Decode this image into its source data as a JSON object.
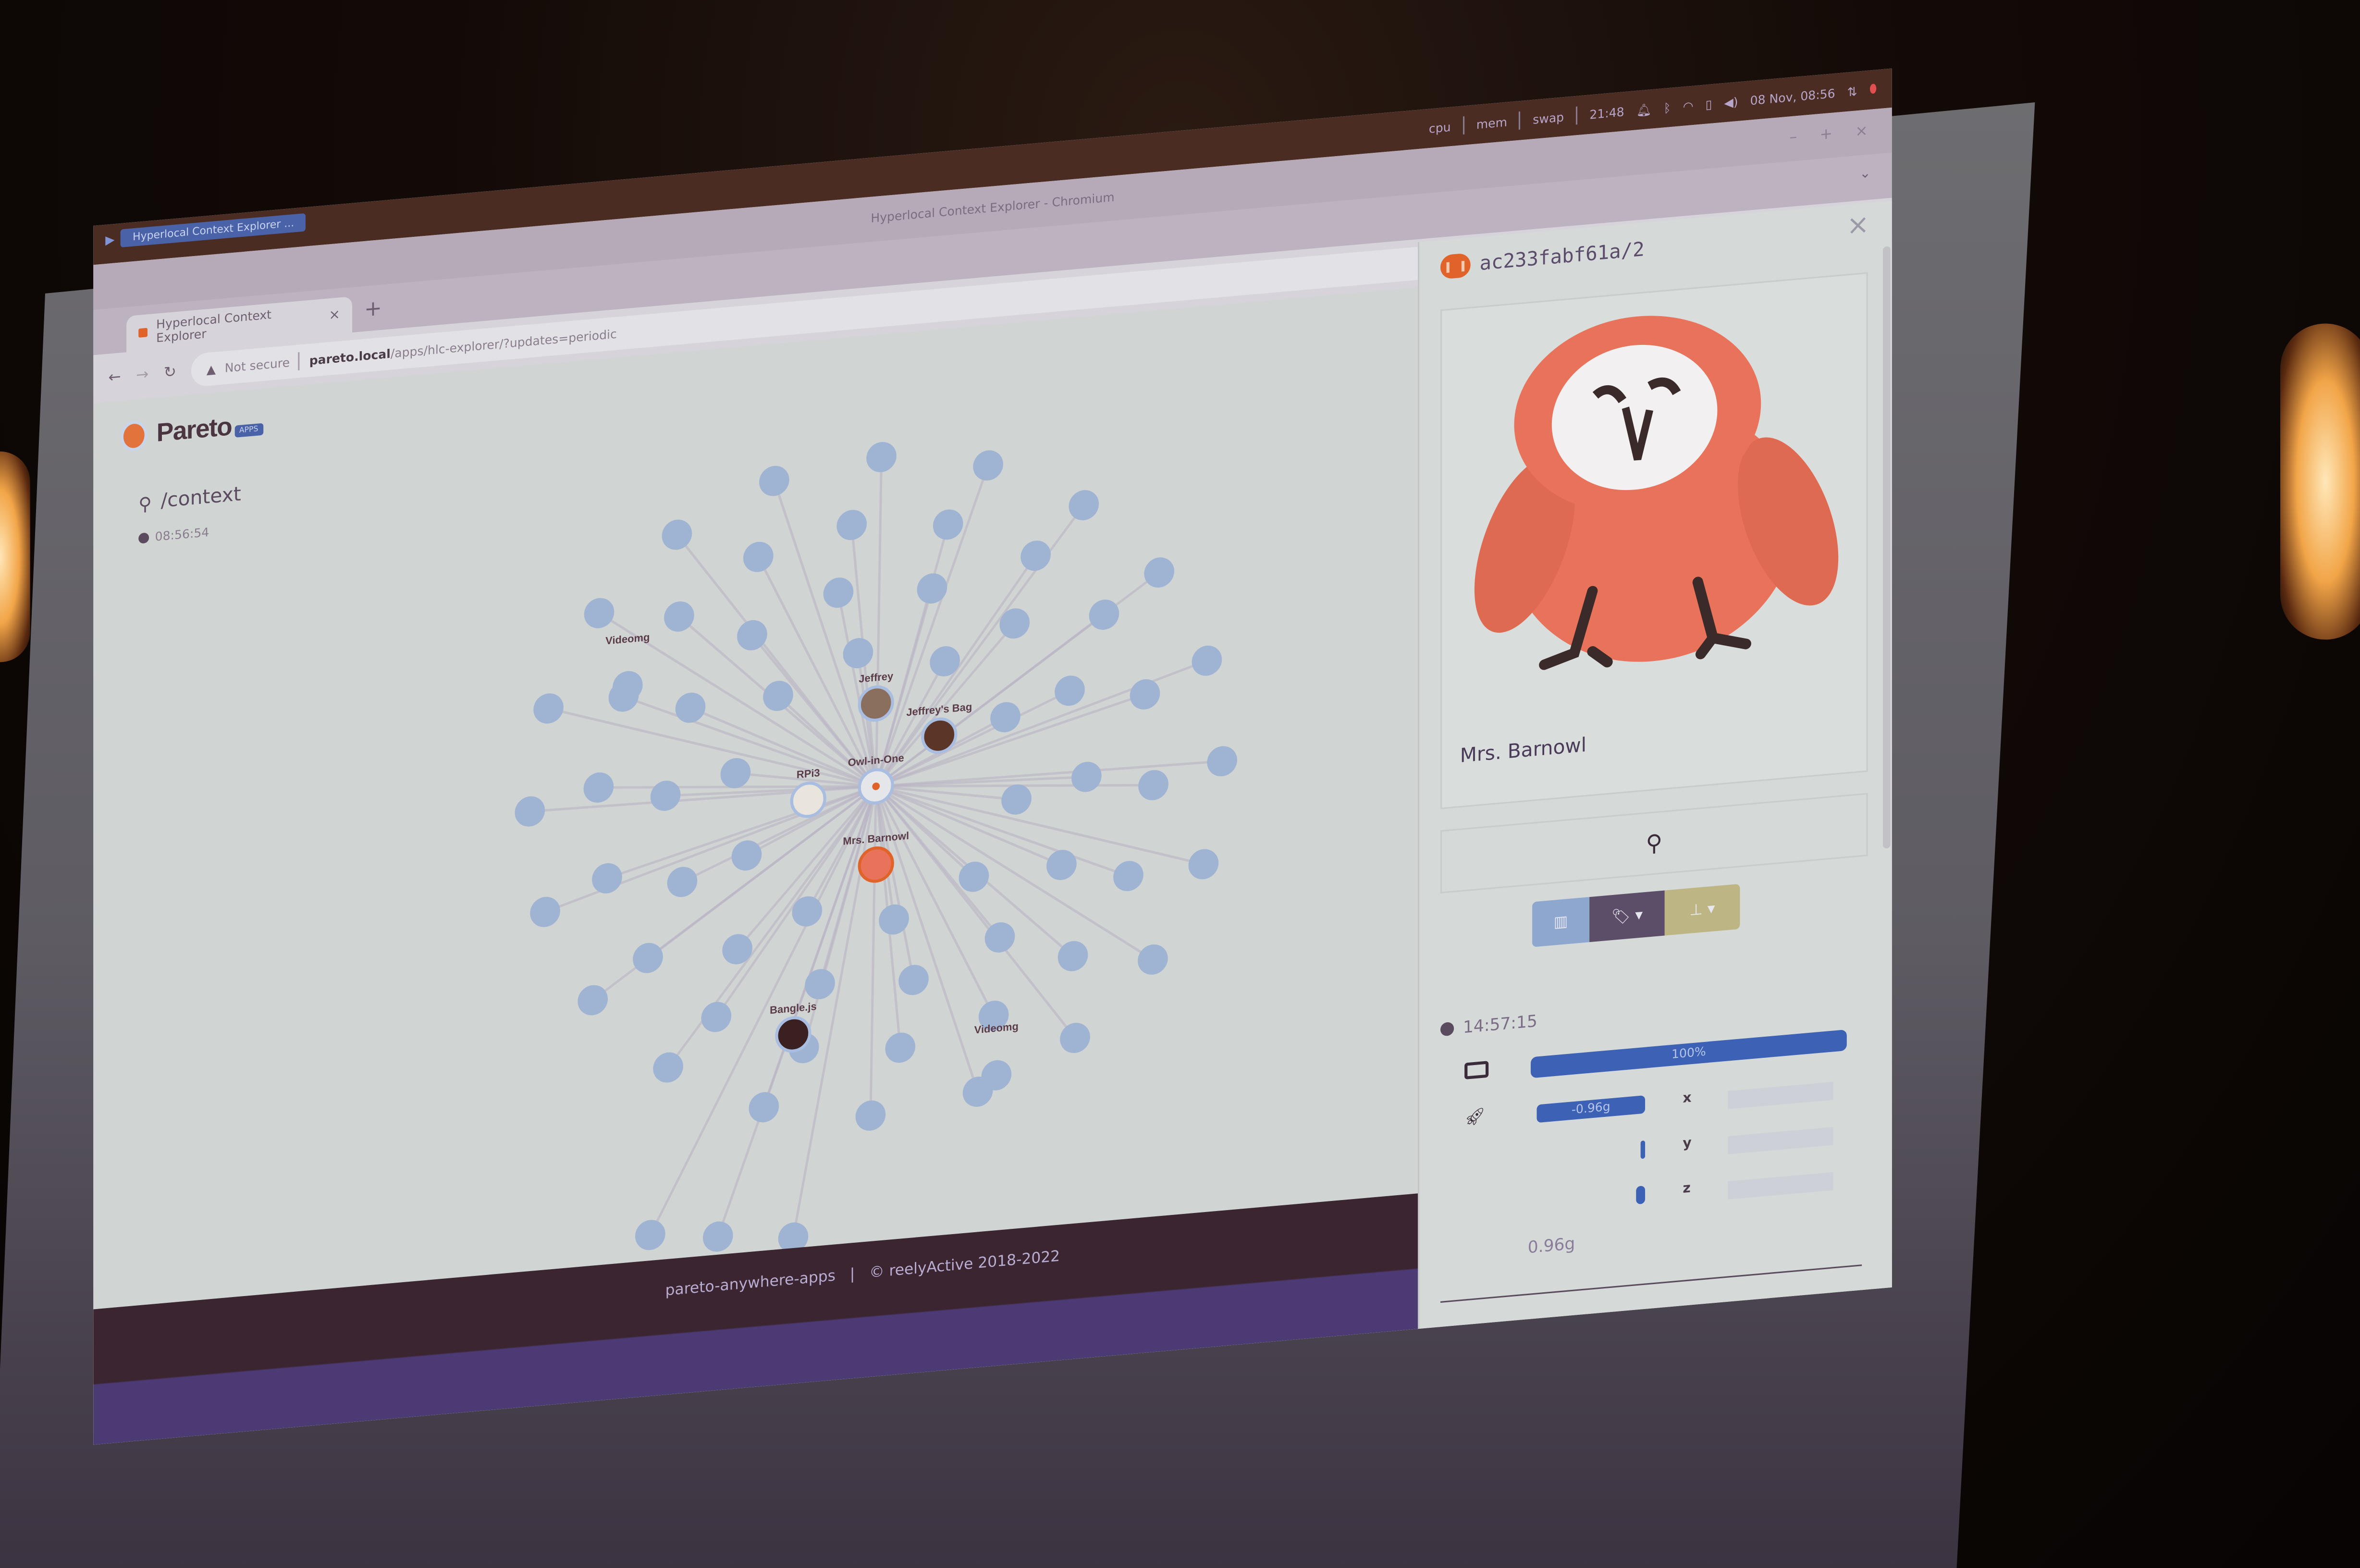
{
  "system_bar": {
    "launcher_tab": "Hyperlocal Context Explorer ...",
    "monitors": [
      "cpu",
      "mem",
      "swap"
    ],
    "counter": "21:48",
    "datetime": "08 Nov, 08:56"
  },
  "window": {
    "title": "Hyperlocal Context Explorer - Chromium"
  },
  "browser": {
    "tab_title": "Hyperlocal Context Explorer",
    "tab_close": "×",
    "new_tab": "+",
    "security_label": "Not secure",
    "url_host": "pareto.local",
    "url_path": "/apps/hlc-explorer/?updates=periodic"
  },
  "app": {
    "brand": "Pareto",
    "brand_badge": "APPS",
    "route": "/context",
    "last_update": "08:56:54",
    "footer": "pareto-anywhere-apps   |   © reelyActive 2018-2022"
  },
  "graph": {
    "center": {
      "label": "Owl-in-One",
      "icon": "owl-in-one-gateway"
    },
    "named_nodes": [
      {
        "label": "Jeffrey",
        "icon": "person-photo"
      },
      {
        "label": "Jeffrey's Bag",
        "icon": "bag-photo"
      },
      {
        "label": "RPi3",
        "icon": "raspberry-pi-photo"
      },
      {
        "label": "Mrs. Barnowl",
        "icon": "owl-photo"
      },
      {
        "label": "Bangle.js",
        "icon": "watch-photo"
      },
      {
        "label": "Videomg",
        "icon": ""
      },
      {
        "label": "Videomg",
        "icon": ""
      }
    ],
    "colors": {
      "node": "#9fb3d3",
      "edge": "#b9b3c3",
      "focus_ring": "#e0632a"
    }
  },
  "detail_panel": {
    "device_id": "ac233fabf61a/2",
    "close": "×",
    "name": "Mrs. Barnowl",
    "last_seen": "14:57:15",
    "battery_percent": 100,
    "battery_label": "100%",
    "acceleration": {
      "x_label": "x",
      "x_value": "-0.96g",
      "x_fraction": 1.0,
      "y_label": "y",
      "y_fraction": 0.02,
      "z_label": "z",
      "z_fraction": 0.08,
      "magnitude": "0.96g"
    },
    "colors": {
      "bar": "#3d62b5",
      "device_badge": "#e0632a",
      "btn_blue": "#8ea7cf",
      "btn_purple": "#5c4d68",
      "btn_gold": "#bdb584"
    }
  }
}
